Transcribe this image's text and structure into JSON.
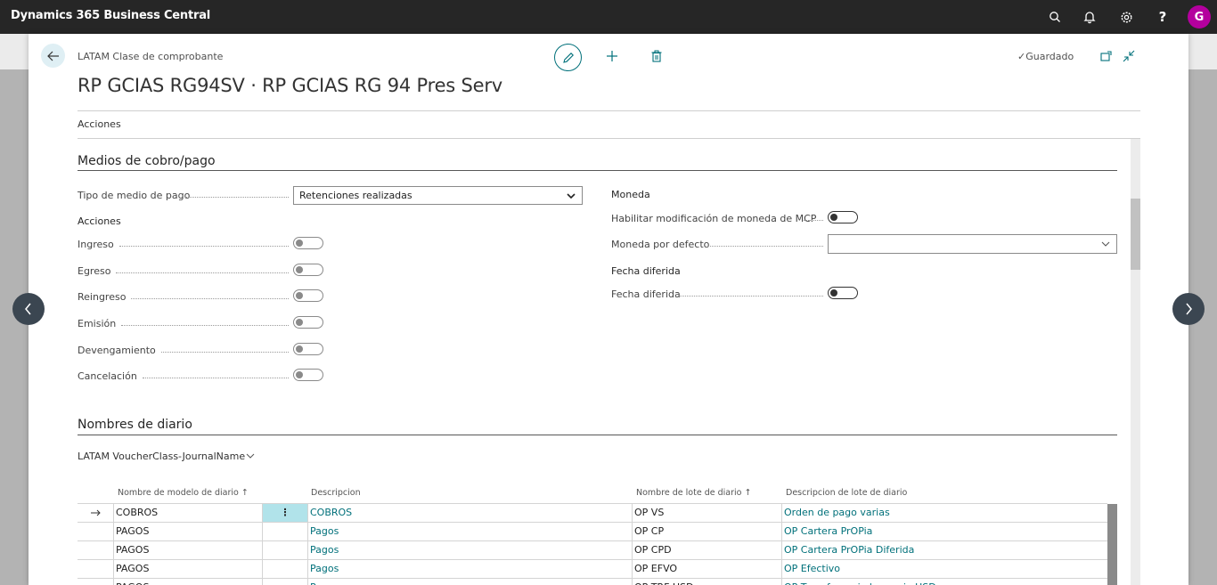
{
  "app": {
    "title": "Dynamics 365 Business Central",
    "avatar_letter": "G"
  },
  "header": {
    "breadcrumb": "LATAM Clase de comprobante",
    "title": "RP GCIAS RG94SV · RP GCIAS RG 94 Pres Serv",
    "saved_label": "Guardado",
    "actions_tab": "Acciones"
  },
  "medios": {
    "title": "Medios de cobro/pago",
    "tipo_label": "Tipo de medio de pago",
    "tipo_value": "Retenciones realizadas",
    "acciones_group": "Acciones",
    "toggles": [
      {
        "label": "Ingreso"
      },
      {
        "label": "Egreso"
      },
      {
        "label": "Reingreso"
      },
      {
        "label": "Emisión"
      },
      {
        "label": "Devengamiento"
      },
      {
        "label": "Cancelación"
      }
    ],
    "moneda_group": "Moneda",
    "habilitar_label": "Habilitar modificación de moneda de MCP",
    "moneda_defecto_label": "Moneda por defecto",
    "moneda_defecto_value": "",
    "fecha_group": "Fecha diferida",
    "fecha_label": "Fecha diferida"
  },
  "diario": {
    "title": "Nombres de diario",
    "subpart_title": "LATAM VoucherClass-JournalName",
    "columns": {
      "modelo": "Nombre de modelo de diario",
      "descripcion": "Descripcion",
      "lote": "Nombre de lote de diario",
      "desc_lote": "Descripcion de lote de diario"
    },
    "rows": [
      {
        "modelo": "COBROS",
        "descripcion": "COBROS",
        "lote": "OP VS",
        "desc_lote": "Orden de pago varias"
      },
      {
        "modelo": "PAGOS",
        "descripcion": "Pagos",
        "lote": "OP CP",
        "desc_lote": "OP Cartera PrOPia"
      },
      {
        "modelo": "PAGOS",
        "descripcion": "Pagos",
        "lote": "OP CPD",
        "desc_lote": "OP Cartera PrOPia Diferida"
      },
      {
        "modelo": "PAGOS",
        "descripcion": "Pagos",
        "lote": "OP EFVO",
        "desc_lote": "OP Efectivo"
      },
      {
        "modelo": "PAGOS",
        "descripcion": "Pagos",
        "lote": "OP TRF USD",
        "desc_lote": "OP Transferencia bancaria USD"
      }
    ]
  },
  "colors": {
    "accent": "#00707a",
    "topbar": "#262626",
    "avatar": "#b4009e"
  }
}
